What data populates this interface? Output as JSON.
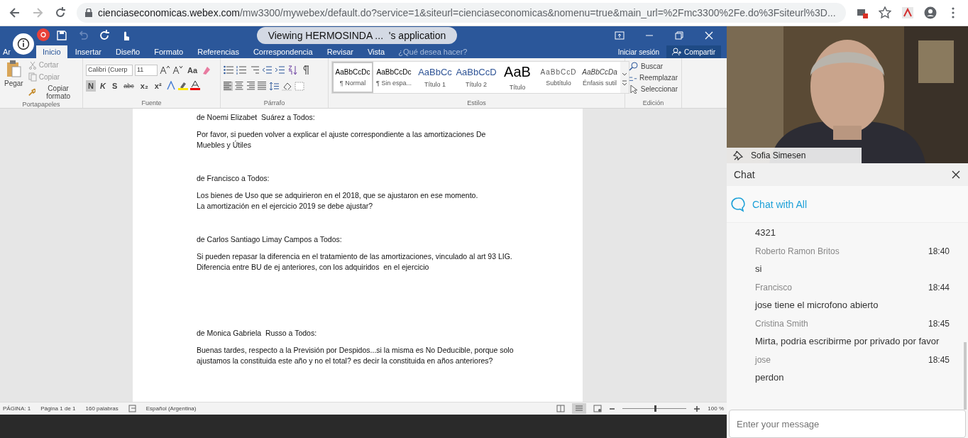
{
  "browser": {
    "url": "cienciaseconomicas.webex.com/mw3300/mywebex/default.do?service=1&siteurl=cienciaseconomicas&nomenu=true&main_url=%2Fmc3300%2Fe.do%3Fsiteurl%3D..."
  },
  "word": {
    "tabs": [
      {
        "label": "Ar",
        "selected": false
      },
      {
        "label": "Inicio",
        "selected": true
      },
      {
        "label": "Insertar",
        "selected": false
      },
      {
        "label": "Diseño",
        "selected": false
      },
      {
        "label": "Formato",
        "selected": false
      },
      {
        "label": "Referencias",
        "selected": false
      },
      {
        "label": "Correspondencia",
        "selected": false
      },
      {
        "label": "Revisar",
        "selected": false
      },
      {
        "label": "Vista",
        "selected": false
      }
    ],
    "tell_me": "¿Qué desea hacer?",
    "sign_in": "Iniciar sesión",
    "share": "Compartir",
    "clipboard": {
      "paste": "Pegar",
      "items": [
        "Cortar",
        "Copiar",
        "Copiar formato"
      ],
      "label": "Portapapeles"
    },
    "font": {
      "name": "Calibri (Cuerp",
      "size": "11",
      "case": "Aa",
      "format": [
        {
          "text": "N",
          "selected": true
        },
        {
          "text": "K",
          "selected": false
        },
        {
          "text": "S",
          "selected": false
        },
        {
          "text": "abc",
          "selected": false
        },
        {
          "text": "x₂",
          "selected": false
        },
        {
          "text": "x²",
          "selected": false
        }
      ],
      "label": "Fuente"
    },
    "paragraph": {
      "label": "Párrafo"
    },
    "styles": {
      "items": [
        {
          "sample": "AaBbCcDc",
          "label": "¶ Normal",
          "kind": "plain",
          "selected": true
        },
        {
          "sample": "AaBbCcDc",
          "label": "¶ Sin espa...",
          "kind": "plain",
          "selected": false
        },
        {
          "sample": "AaBbCc",
          "label": "Título 1",
          "kind": "heading",
          "selected": false
        },
        {
          "sample": "AaBbCcD",
          "label": "Título 2",
          "kind": "heading",
          "selected": false
        },
        {
          "sample": "AaB",
          "label": "Título",
          "kind": "title",
          "selected": false
        },
        {
          "sample": "AaBbCcD",
          "label": "Subtítulo",
          "kind": "subtle",
          "selected": false
        },
        {
          "sample": "AaBbCcDa",
          "label": "Énfasis sutil",
          "kind": "emphasis",
          "selected": false
        }
      ],
      "label": "Estilos"
    },
    "editing": {
      "items": [
        "Buscar",
        "Reemplazar",
        "Seleccionar"
      ],
      "label": "Edición"
    },
    "document": [
      {
        "from": "de Noemi Elizabet  Suárez a Todos:",
        "body": [
          "Por favor, si pueden volver a explicar el ajuste correspondiente a las amortizaciones De",
          "Muebles y Útiles"
        ]
      },
      {
        "from": "de Francisco a Todos:",
        "body": [
          "Los bienes de Uso que se adquirieron en el 2018, que se ajustaron en ese momento.",
          "La amortización en el ejercicio 2019 se debe ajustar?"
        ]
      },
      {
        "from": "de Carlos Santiago Limay Campos a Todos:",
        "body": [
          "Si pueden repasar la diferencia en el tratamiento de las amortizaciones, vinculado al art 93 LIG.",
          "Diferencia entre BU de ej anteriores, con los adquiridos  en el ejercicio"
        ]
      },
      {
        "from": "de Monica Gabriela  Russo a Todos:",
        "body": [
          "Buenas tardes, respecto a la Previsión por Despidos...si la misma es No Deducible, porque solo",
          "ajustamos la constituida este año y no el total? es decir la constituida en años anteriores?"
        ]
      }
    ],
    "status": {
      "items": [
        "PÁGINA: 1",
        "Página 1 de 1",
        "160 palabras",
        "Español (Argentina)"
      ],
      "zoom": "100 %",
      "zoom_level": {
        "level": 0.5
      }
    }
  },
  "webex": {
    "banner": "Viewing HERMOSINDA ...  's application",
    "video": {
      "name": "Sofia Simesen"
    },
    "chat": {
      "title": "Chat",
      "channel": "Chat with All",
      "messages": [
        {
          "text": "4321"
        },
        {
          "sender": "Roberto Ramon Britos",
          "time": "18:40",
          "text": "si"
        },
        {
          "sender": "Francisco",
          "time": "18:44",
          "text": "jose tiene el microfono abierto"
        },
        {
          "sender": "Cristina Smith",
          "time": "18:45",
          "text": "Mirta, podria escribirme por privado por favor"
        },
        {
          "sender": "jose",
          "time": "18:45",
          "text": "perdon"
        }
      ],
      "input": {
        "placeholder": "Enter your message"
      }
    }
  }
}
